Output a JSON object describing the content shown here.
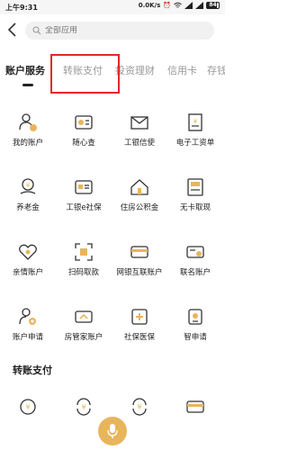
{
  "status": {
    "time": "上午9:31",
    "speed": "0.0K/s",
    "battery": "84"
  },
  "search": {
    "placeholder": "全部应用"
  },
  "tabs": [
    {
      "label": "账户服务",
      "active": true
    },
    {
      "label": "转账支付",
      "active": false
    },
    {
      "label": "投资理财",
      "active": false
    },
    {
      "label": "信用卡",
      "active": false
    },
    {
      "label": "存钱",
      "active": false
    }
  ],
  "grid": [
    {
      "label": "我的账户",
      "icon": "user-account-icon"
    },
    {
      "label": "随心查",
      "icon": "card-search-icon"
    },
    {
      "label": "工银信使",
      "icon": "envelope-icon"
    },
    {
      "label": "电子工资单",
      "icon": "salary-document-icon"
    },
    {
      "label": "养老金",
      "icon": "pension-icon"
    },
    {
      "label": "工银e社保",
      "icon": "social-security-card-icon"
    },
    {
      "label": "住房公积金",
      "icon": "house-icon"
    },
    {
      "label": "无卡取现",
      "icon": "atm-icon"
    },
    {
      "label": "亲情账户",
      "icon": "heart-icon"
    },
    {
      "label": "扫码取款",
      "icon": "scan-atm-icon"
    },
    {
      "label": "网银互联账户",
      "icon": "linked-card-icon"
    },
    {
      "label": "联名账户",
      "icon": "joint-card-icon"
    },
    {
      "label": "账户申请",
      "icon": "account-apply-icon"
    },
    {
      "label": "房管家账户",
      "icon": "house-card-icon"
    },
    {
      "label": "社保医保",
      "icon": "medical-card-icon"
    },
    {
      "label": "智申请",
      "icon": "smart-apply-icon"
    }
  ],
  "section2": {
    "title": "转账支付"
  },
  "colors": {
    "accent": "#e8b55c",
    "highlight": "#e5252a"
  }
}
